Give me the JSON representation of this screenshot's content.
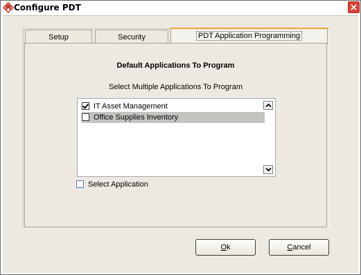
{
  "window": {
    "title": "Configure PDT",
    "app_icon": "diamond-arrows-icon",
    "close_icon": "close-icon",
    "close_color": "#d8473a"
  },
  "tabs": [
    {
      "label": "Setup",
      "active": false
    },
    {
      "label": "Security",
      "active": false
    },
    {
      "label": "PDT Application Programming",
      "active": true
    }
  ],
  "content": {
    "heading": "Default Applications To Program",
    "subheading": "Select Multiple Applications To Program",
    "applications": [
      {
        "label": "IT Asset Management",
        "checked": true,
        "selected": false
      },
      {
        "label": "Office Supplies Inventory",
        "checked": false,
        "selected": true
      }
    ],
    "scroll_up_icon": "chevron-up-icon",
    "scroll_down_icon": "chevron-down-icon",
    "select_application_label": "Select Application",
    "select_application_checked": false
  },
  "buttons": {
    "ok": {
      "mnemonic": "O",
      "rest": "k"
    },
    "cancel": {
      "mnemonic": "C",
      "rest": "ancel"
    }
  },
  "accent_color": "#f4a12f"
}
